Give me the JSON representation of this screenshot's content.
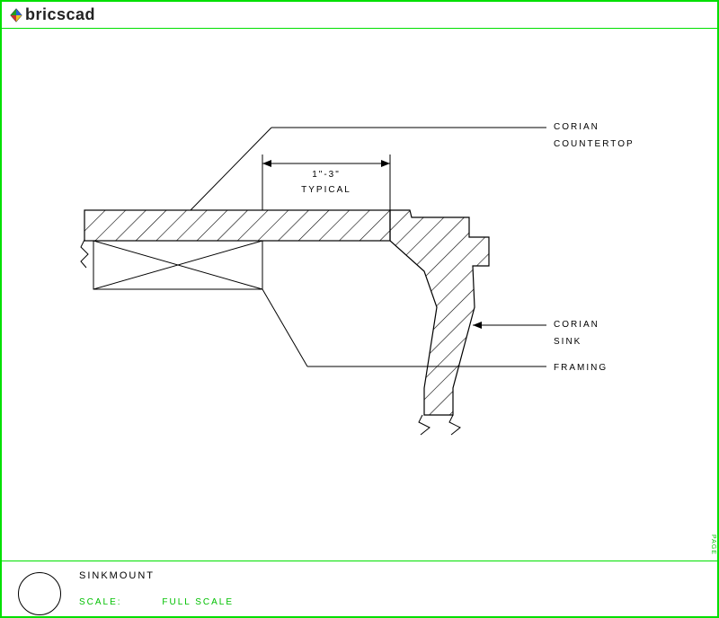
{
  "brand": "bricscad",
  "annotations": {
    "countertop_line1": "CORIAN",
    "countertop_line2": "COUNTERTOP",
    "sink_line1": "CORIAN",
    "sink_line2": "SINK",
    "framing": "FRAMING",
    "dim_value": "1\"-3\"",
    "dim_label": "TYPICAL"
  },
  "footer": {
    "title": "SINKMOUNT",
    "scale_label": "SCALE:",
    "scale_value": "FULL SCALE"
  },
  "side": "PAGE"
}
